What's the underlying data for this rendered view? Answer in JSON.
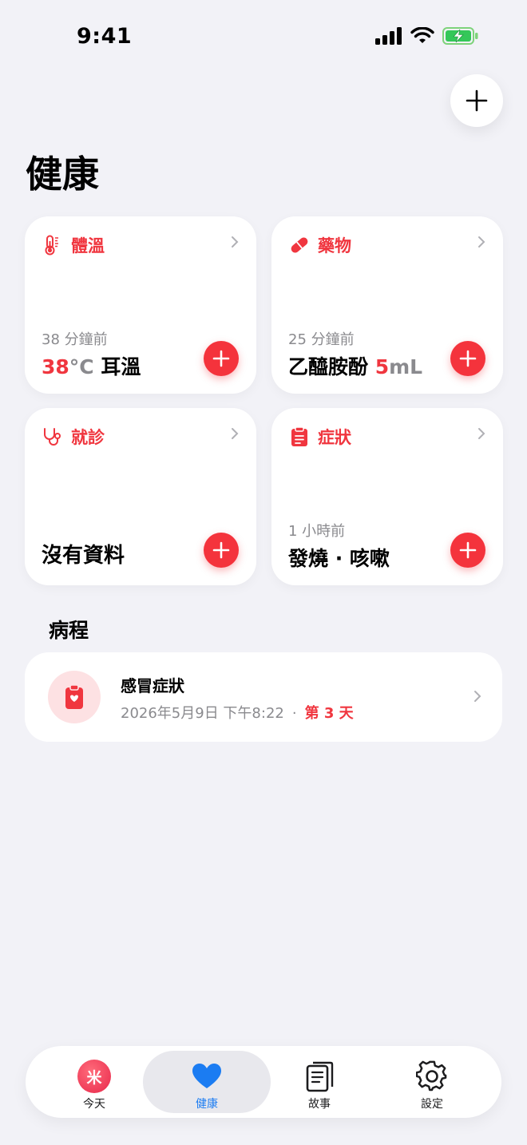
{
  "status_bar": {
    "time": "9:41"
  },
  "header": {
    "title": "健康"
  },
  "cards": [
    {
      "title": "體溫",
      "time": "38 分鐘前",
      "value_num": "38",
      "value_unit": "°C",
      "value_text": " 耳溫"
    },
    {
      "title": "藥物",
      "time": "25 分鐘前",
      "value_text": "乙醯胺酚 ",
      "value_num": "5",
      "value_unit": "mL"
    },
    {
      "title": "就診",
      "time": "",
      "value_text": "沒有資料"
    },
    {
      "title": "症狀",
      "time": "1 小時前",
      "value_text": "發燒 · 咳嗽"
    }
  ],
  "episodes": {
    "section_title": "病程",
    "items": [
      {
        "title": "感冒症狀",
        "date": "2026年5月9日 下午8:22",
        "separator": "·",
        "day_label": "第 3 天"
      }
    ]
  },
  "tabbar": {
    "today_badge": "米",
    "items": [
      {
        "label": "今天"
      },
      {
        "label": "健康"
      },
      {
        "label": "故事"
      },
      {
        "label": "設定"
      }
    ]
  },
  "colors": {
    "accent_red": "#f0363f",
    "tab_active_blue": "#1b7cf2",
    "background": "#f2f2f7"
  }
}
